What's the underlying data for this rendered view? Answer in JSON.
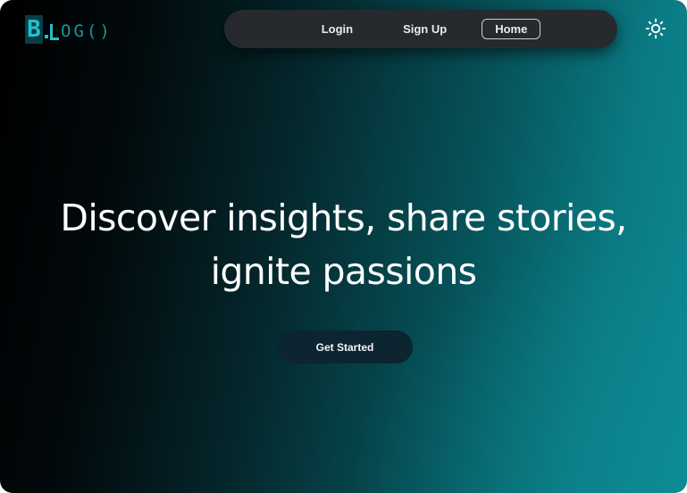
{
  "logo": {
    "first_letter": "B",
    "rest": "OG()"
  },
  "nav": {
    "login_label": "Login",
    "signup_label": "Sign Up",
    "home_label": "Home"
  },
  "theme_toggle": {
    "icon": "sun-icon"
  },
  "hero": {
    "title_line1": "Discover insights, share stories,",
    "title_line2": "ignite passions",
    "cta_label": "Get Started"
  },
  "colors": {
    "accent": "#20c2cc",
    "gradient_dark": "#000000",
    "gradient_light": "#0d8a92",
    "nav_bg": "#262a2e",
    "cta_bg": "#0c2530"
  }
}
